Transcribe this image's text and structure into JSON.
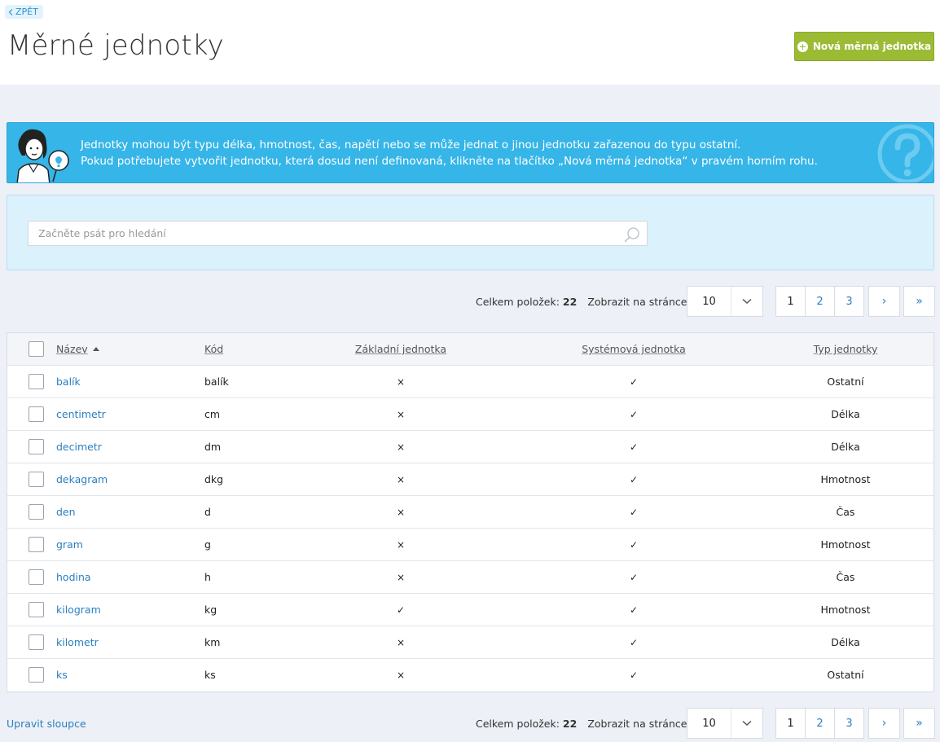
{
  "header": {
    "back_label": "ZPĚT",
    "title": "Měrné jednotky",
    "new_button_label": "Nová měrná jednotka"
  },
  "info": {
    "line1": "Jednotky mohou být typu délka, hmotnost, čas, napětí nebo se může jednat o jinou jednotku zařazenou do typu ostatní.",
    "line2": "Pokud potřebujete vytvořit jednotku, která dosud není definovaná, klikněte na tlačítko „Nová měrná jednotka“ v pravém horním rohu."
  },
  "search": {
    "placeholder": "Začněte psát pro hledání"
  },
  "pager": {
    "total_label": "Celkem položek:",
    "total_value": "22",
    "per_page_label": "Zobrazit na stránce:",
    "per_page_value": "10",
    "pages": [
      "1",
      "2",
      "3"
    ],
    "next": "›",
    "last": "»"
  },
  "table": {
    "columns": {
      "name": "Název",
      "code": "Kód",
      "base": "Základní jednotka",
      "system": "Systémová jednotka",
      "type": "Typ jednotky"
    },
    "rows": [
      {
        "name": "balík",
        "code": "balík",
        "base": "×",
        "system": "✓",
        "type": "Ostatní"
      },
      {
        "name": "centimetr",
        "code": "cm",
        "base": "×",
        "system": "✓",
        "type": "Délka"
      },
      {
        "name": "decimetr",
        "code": "dm",
        "base": "×",
        "system": "✓",
        "type": "Délka"
      },
      {
        "name": "dekagram",
        "code": "dkg",
        "base": "×",
        "system": "✓",
        "type": "Hmotnost"
      },
      {
        "name": "den",
        "code": "d",
        "base": "×",
        "system": "✓",
        "type": "Čas"
      },
      {
        "name": "gram",
        "code": "g",
        "base": "×",
        "system": "✓",
        "type": "Hmotnost"
      },
      {
        "name": "hodina",
        "code": "h",
        "base": "×",
        "system": "✓",
        "type": "Čas"
      },
      {
        "name": "kilogram",
        "code": "kg",
        "base": "✓",
        "system": "✓",
        "type": "Hmotnost"
      },
      {
        "name": "kilometr",
        "code": "km",
        "base": "×",
        "system": "✓",
        "type": "Délka"
      },
      {
        "name": "ks",
        "code": "ks",
        "base": "×",
        "system": "✓",
        "type": "Ostatní"
      }
    ]
  },
  "footer": {
    "edit_columns_label": "Upravit sloupce"
  },
  "colors": {
    "accent_green": "#9cbb35",
    "info_blue": "#35b5e8",
    "link_blue": "#2a7fc0"
  }
}
